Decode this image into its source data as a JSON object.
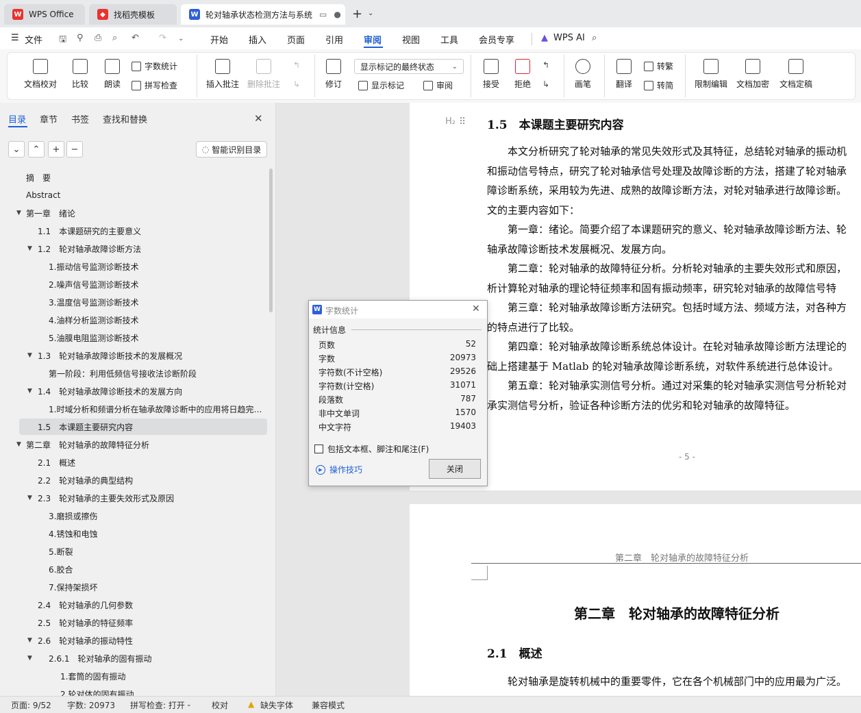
{
  "tabs": [
    {
      "label": "WPS Office"
    },
    {
      "label": "找稻壳模板"
    },
    {
      "label": "轮对轴承状态检测方法与系统"
    }
  ],
  "menu": {
    "file": "文件",
    "items": [
      "开始",
      "插入",
      "页面",
      "引用",
      "审阅",
      "视图",
      "工具",
      "会员专享"
    ],
    "active": "审阅",
    "wps_ai": "WPS AI"
  },
  "ribbon": {
    "doc_check": "文档校对",
    "compare": "比较",
    "read_aloud": "朗读",
    "word_count": "字数统计",
    "spell_check": "拼写检查",
    "insert_comment": "插入批注",
    "delete_comment": "删除批注",
    "revise": "修订",
    "display_state": "显示标记的最终状态",
    "show_markup": "显示标记",
    "review": "审阅",
    "accept": "接受",
    "reject": "拒绝",
    "pen": "画笔",
    "translate": "翻译",
    "to_traditional": "转繁",
    "to_simplified": "转简",
    "restrict_edit": "限制编辑",
    "encrypt": "文档加密",
    "finalize": "文档定稿"
  },
  "nav": {
    "tabs": [
      "目录",
      "章节",
      "书签",
      "查找和替换"
    ],
    "active_tab": "目录",
    "smart_toc": "智能识别目录",
    "toc": [
      {
        "label": "摘　要",
        "level": 0,
        "arrow": false
      },
      {
        "label": "Abstract",
        "level": 0,
        "arrow": false
      },
      {
        "label": "第一章　绪论",
        "level": 0,
        "arrow": true
      },
      {
        "label": "1.1　本课题研究的主要意义",
        "level": 1,
        "arrow": false
      },
      {
        "label": "1.2　轮对轴承故障诊断方法",
        "level": 1,
        "arrow": true
      },
      {
        "label": "1.振动信号监测诊断技术",
        "level": 2,
        "arrow": false
      },
      {
        "label": "2.噪声信号监测诊断技术",
        "level": 2,
        "arrow": false
      },
      {
        "label": "3.温度信号监测诊断技术",
        "level": 2,
        "arrow": false
      },
      {
        "label": "4.油样分析监测诊断技术",
        "level": 2,
        "arrow": false
      },
      {
        "label": "5.油膜电阻监测诊断技术",
        "level": 2,
        "arrow": false
      },
      {
        "label": "1.3　轮对轴承故障诊断技术的发展概况",
        "level": 1,
        "arrow": true
      },
      {
        "label": "第一阶段：利用低频信号接收法诊断阶段",
        "level": 2,
        "arrow": false
      },
      {
        "label": "1.4　轮对轴承故障诊断技术的发展方向",
        "level": 1,
        "arrow": true
      },
      {
        "label": "1.时域分析和频谱分析在轴承故障诊断中的应用将日趋完…",
        "level": 2,
        "arrow": false
      },
      {
        "label": "1.5　本课题主要研究内容",
        "level": 1,
        "arrow": false,
        "selected": true
      },
      {
        "label": "第二章　轮对轴承的故障特征分析",
        "level": 0,
        "arrow": true
      },
      {
        "label": "2.1　概述",
        "level": 1,
        "arrow": false
      },
      {
        "label": "2.2　轮对轴承的典型结构",
        "level": 1,
        "arrow": false
      },
      {
        "label": "2.3　轮对轴承的主要失效形式及原因",
        "level": 1,
        "arrow": true
      },
      {
        "label": "3.磨损或擦伤",
        "level": 2,
        "arrow": false
      },
      {
        "label": "4.锈蚀和电蚀",
        "level": 2,
        "arrow": false
      },
      {
        "label": "5.断裂",
        "level": 2,
        "arrow": false
      },
      {
        "label": "6.胶合",
        "level": 2,
        "arrow": false
      },
      {
        "label": "7.保持架损坏",
        "level": 2,
        "arrow": false
      },
      {
        "label": "2.4　轮对轴承的几何参数",
        "level": 1,
        "arrow": false
      },
      {
        "label": "2.5　轮对轴承的特征频率",
        "level": 1,
        "arrow": false
      },
      {
        "label": "2.6　轮对轴承的振动特性",
        "level": 1,
        "arrow": true
      },
      {
        "label": "2.6.1　轮对轴承的固有振动",
        "level": 2,
        "arrow": true
      },
      {
        "label": "1.套筒的固有振动",
        "level": 3,
        "arrow": false
      },
      {
        "label": "2.轮对体的固有振动",
        "level": 3,
        "arrow": false
      }
    ]
  },
  "doc": {
    "h2_marker": "H₂",
    "sec_title": "1.5　本课题主要研究内容",
    "lines": [
      "　　本文分析研究了轮对轴承的常见失效形式及其特征，总结轮对轴承的振动机",
      "和振动信号特点，研究了轮对轴承信号处理及故障诊断的方法，搭建了轮对轴承",
      "障诊断系统，采用较为先进、成熟的故障诊断方法，对轮对轴承进行故障诊断。",
      "文的主要内容如下：",
      "　　第一章：绪论。简要介绍了本课题研究的意义、轮对轴承故障诊断方法、轮",
      "轴承故障诊断技术发展概况、发展方向。",
      "　　第二章：轮对轴承的故障特征分析。分析轮对轴承的主要失效形式和原因，",
      "析计算轮对轴承的理论特征频率和固有振动频率，研究轮对轴承的故障信号特",
      "　　第三章：轮对轴承故障诊断方法研究。包括时域方法、频域方法，对各种方",
      "的特点进行了比较。",
      "　　第四章：轮对轴承故障诊断系统总体设计。在轮对轴承故障诊断方法理论的",
      "础上搭建基于 Matlab 的轮对轴承故障诊断系统，对软件系统进行总体设计。",
      "　　第五章：轮对轴承实测信号分析。通过对采集的轮对轴承实测信号分析轮对",
      "承实测信号分析，验证各种诊断方法的优劣和轮对轴承的故障特征。"
    ],
    "page_num": "- 5 -",
    "header": "第二章　轮对轴承的故障特征分析",
    "chapter_title": "第二章　轮对轴承的故障特征分析",
    "sec21": "2.1　概述",
    "p21": "　　轮对轴承是旋转机械中的重要零件，它在各个机械部门中的应用最为广泛。"
  },
  "dialog": {
    "title": "字数统计",
    "section": "统计信息",
    "rows": [
      {
        "label": "页数",
        "value": "52"
      },
      {
        "label": "字数",
        "value": "20973"
      },
      {
        "label": "字符数(不计空格)",
        "value": "29526"
      },
      {
        "label": "字符数(计空格)",
        "value": "31071"
      },
      {
        "label": "段落数",
        "value": "787"
      },
      {
        "label": "非中文单词",
        "value": "1570"
      },
      {
        "label": "中文字符",
        "value": "19403"
      }
    ],
    "checkbox": "包括文本框、脚注和尾注(F)",
    "tips": "操作技巧",
    "close": "关闭"
  },
  "status": {
    "page": "页面: 9/52",
    "words": "字数: 20973",
    "spell": "拼写检查: 打开",
    "proof": "校对",
    "missing_font": "缺失字体",
    "compat": "兼容模式"
  },
  "colors": {
    "accent": "#1f5fd6",
    "wps_red": "#e8332f",
    "dialog_bg": "#f3f3f3"
  }
}
